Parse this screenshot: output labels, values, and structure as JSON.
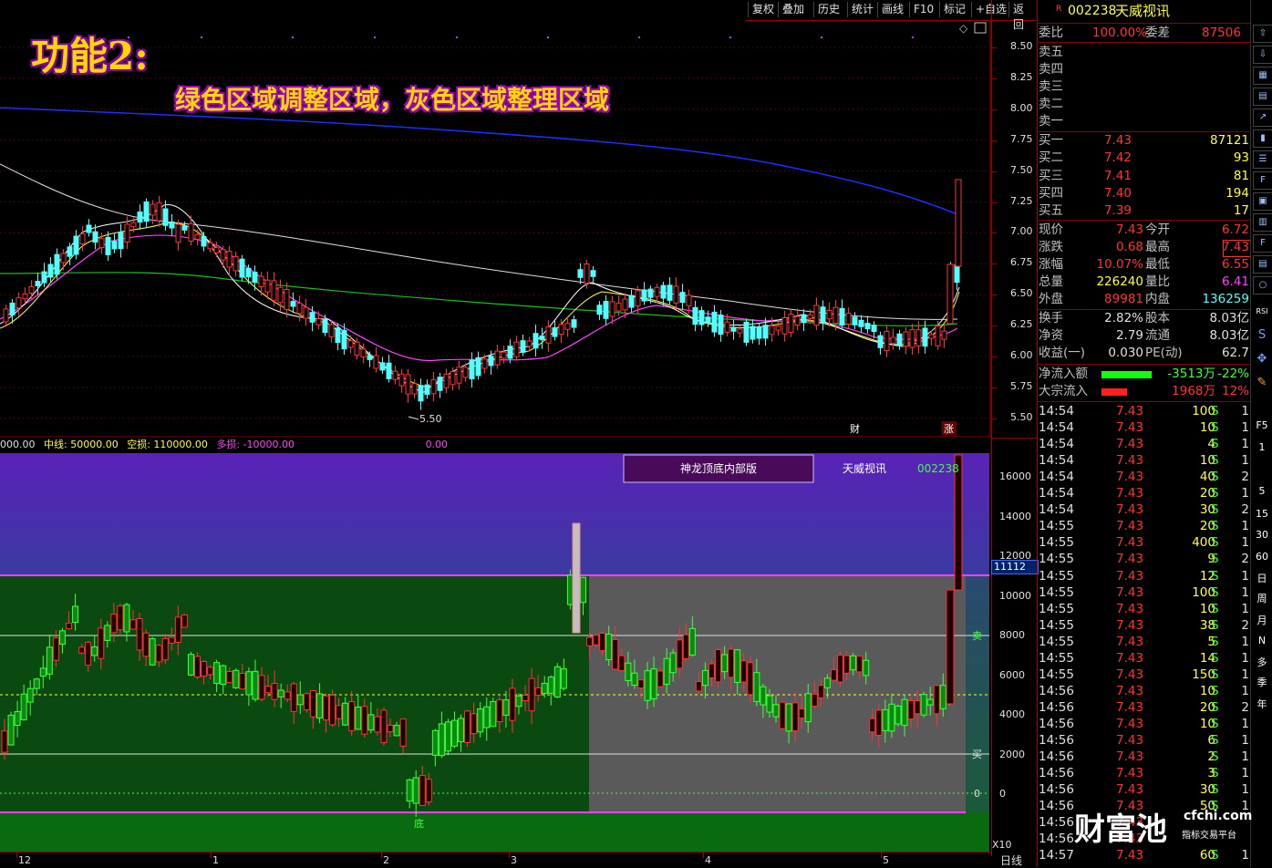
{
  "toolbar": {
    "buttons": [
      "复权",
      "叠加",
      "历史",
      "统计",
      "画线",
      "F10",
      "标记",
      "+自选",
      "返回"
    ]
  },
  "overlay": {
    "title": "功能2:",
    "subtitle": "绿色区域调整区域，灰色区域整理区域"
  },
  "main_chart": {
    "price_axis": [
      "8.50",
      "8.25",
      "8.00",
      "7.75",
      "7.50",
      "7.25",
      "7.00",
      "6.75",
      "6.50",
      "6.25",
      "6.00",
      "5.75",
      "5.50"
    ],
    "low_mark": "5.50",
    "marker_cai": "财",
    "marker_zhang": "涨"
  },
  "indicator_bar": {
    "prefix": "000.00",
    "mid": "中线: 50000.00",
    "kong": "空损: 110000.00",
    "duo": "多损: -10000.00",
    "val": "0.00"
  },
  "sub_chart": {
    "panel_title": "神龙顶底内部版",
    "stock_name": "天威视讯",
    "stock_code": "002238",
    "axis": [
      "16000",
      "14000",
      "12000",
      "10000",
      "8000",
      "6000",
      "4000",
      "2000",
      "0"
    ],
    "current_value": "11112",
    "sell_label": "卖",
    "buy_label": "买",
    "zero_label": "0",
    "bottom_label": "底",
    "zoom": "X10"
  },
  "date_axis": {
    "labels": [
      "12",
      "1",
      "2",
      "3",
      "4",
      "5"
    ],
    "period": "日线"
  },
  "quote": {
    "code": "002238",
    "name": "天威视讯",
    "r_badge": "R",
    "weibi_label": "委比",
    "weibi": "100.00%",
    "weicha_label": "委差",
    "weicha": "87506",
    "sell": [
      {
        "label": "卖五",
        "price": "",
        "vol": ""
      },
      {
        "label": "卖四",
        "price": "",
        "vol": ""
      },
      {
        "label": "卖三",
        "price": "",
        "vol": ""
      },
      {
        "label": "卖二",
        "price": "",
        "vol": ""
      },
      {
        "label": "卖一",
        "price": "",
        "vol": ""
      }
    ],
    "buy": [
      {
        "label": "买一",
        "price": "7.43",
        "vol": "87121"
      },
      {
        "label": "买二",
        "price": "7.42",
        "vol": "93"
      },
      {
        "label": "买三",
        "price": "7.41",
        "vol": "81"
      },
      {
        "label": "买四",
        "price": "7.40",
        "vol": "194"
      },
      {
        "label": "买五",
        "price": "7.39",
        "vol": "17"
      }
    ],
    "stats": [
      {
        "l1": "现价",
        "v1": "7.43",
        "l2": "今开",
        "v2": "6.72"
      },
      {
        "l1": "涨跌",
        "v1": "0.68",
        "l2": "最高",
        "v2": "7.43"
      },
      {
        "l1": "涨幅",
        "v1": "10.07%",
        "l2": "最低",
        "v2": "6.55"
      },
      {
        "l1": "总量",
        "v1": "226240",
        "l2": "量比",
        "v2": "6.41"
      },
      {
        "l1": "外盘",
        "v1": "89981",
        "l2": "内盘",
        "v2": "136259"
      }
    ],
    "stats2": [
      {
        "l1": "换手",
        "v1": "2.82%",
        "l2": "股本",
        "v2": "8.03亿"
      },
      {
        "l1": "净资",
        "v1": "2.79",
        "l2": "流通",
        "v2": "8.03亿"
      },
      {
        "l1": "收益(一)",
        "v1": "0.030",
        "l2": "PE(动)",
        "v2": "62.7"
      }
    ],
    "flow": [
      {
        "label": "净流入额",
        "value": "-3513万",
        "pct": "-22%"
      },
      {
        "label": "大宗流入",
        "value": "1968万",
        "pct": "12%"
      }
    ],
    "ticks": [
      {
        "t": "14:54",
        "p": "7.43",
        "v": "100",
        "s": "S",
        "n": "1"
      },
      {
        "t": "14:54",
        "p": "7.43",
        "v": "10",
        "s": "S",
        "n": "1"
      },
      {
        "t": "14:54",
        "p": "7.43",
        "v": "4",
        "s": "S",
        "n": "1"
      },
      {
        "t": "14:54",
        "p": "7.43",
        "v": "10",
        "s": "S",
        "n": "1"
      },
      {
        "t": "14:54",
        "p": "7.43",
        "v": "40",
        "s": "S",
        "n": "2"
      },
      {
        "t": "14:54",
        "p": "7.43",
        "v": "20",
        "s": "S",
        "n": "1"
      },
      {
        "t": "14:54",
        "p": "7.43",
        "v": "30",
        "s": "S",
        "n": "2"
      },
      {
        "t": "14:55",
        "p": "7.43",
        "v": "20",
        "s": "S",
        "n": "1"
      },
      {
        "t": "14:55",
        "p": "7.43",
        "v": "400",
        "s": "S",
        "n": "1"
      },
      {
        "t": "14:55",
        "p": "7.43",
        "v": "9",
        "s": "S",
        "n": "2"
      },
      {
        "t": "14:55",
        "p": "7.43",
        "v": "12",
        "s": "S",
        "n": "1"
      },
      {
        "t": "14:55",
        "p": "7.43",
        "v": "100",
        "s": "S",
        "n": "1"
      },
      {
        "t": "14:55",
        "p": "7.43",
        "v": "10",
        "s": "S",
        "n": "1"
      },
      {
        "t": "14:55",
        "p": "7.43",
        "v": "38",
        "s": "S",
        "n": "2"
      },
      {
        "t": "14:55",
        "p": "7.43",
        "v": "5",
        "s": "S",
        "n": "1"
      },
      {
        "t": "14:55",
        "p": "7.43",
        "v": "14",
        "s": "S",
        "n": "1"
      },
      {
        "t": "14:55",
        "p": "7.43",
        "v": "150",
        "s": "S",
        "n": "1"
      },
      {
        "t": "14:56",
        "p": "7.43",
        "v": "10",
        "s": "S",
        "n": "1"
      },
      {
        "t": "14:56",
        "p": "7.43",
        "v": "20",
        "s": "S",
        "n": "2"
      },
      {
        "t": "14:56",
        "p": "7.43",
        "v": "10",
        "s": "S",
        "n": "1"
      },
      {
        "t": "14:56",
        "p": "7.43",
        "v": "6",
        "s": "S",
        "n": "1"
      },
      {
        "t": "14:56",
        "p": "7.43",
        "v": "2",
        "s": "S",
        "n": "1"
      },
      {
        "t": "14:56",
        "p": "7.43",
        "v": "3",
        "s": "S",
        "n": "1"
      },
      {
        "t": "14:56",
        "p": "7.43",
        "v": "30",
        "s": "S",
        "n": "1"
      },
      {
        "t": "14:56",
        "p": "7.43",
        "v": "50",
        "s": "S",
        "n": "1"
      },
      {
        "t": "14:56",
        "p": "7.43",
        "v": "",
        "s": "",
        "n": ""
      },
      {
        "t": "14:56",
        "p": "7.43",
        "v": "",
        "s": "",
        "n": ""
      },
      {
        "t": "14:57",
        "p": "7.43",
        "v": "60",
        "s": "S",
        "n": "1"
      }
    ]
  },
  "right_tools": [
    "RSI",
    "F5",
    "1",
    "5",
    "15",
    "30",
    "60",
    "日",
    "周",
    "月",
    "N",
    "多",
    "季",
    "年"
  ],
  "watermark": {
    "brand": "财富池",
    "site": "cfchi.com",
    "tag": "指标交易平台"
  },
  "colors": {
    "up": "#ff3333",
    "down": "#54ffff",
    "green_zone": "#0a4a10",
    "gray_zone": "#555555",
    "purple_top": "#5a2ab0"
  }
}
